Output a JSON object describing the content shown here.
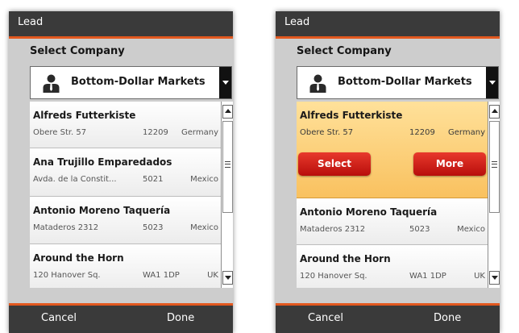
{
  "screens": [
    {
      "title": "Lead",
      "section_label": "Select Company",
      "dropdown": {
        "value": "Bottom-Dollar Markets",
        "icon": "person-icon"
      },
      "items": [
        {
          "name": "Alfreds Futterkiste",
          "address": "Obere Str. 57",
          "postal": "12209",
          "country": "Germany"
        },
        {
          "name": "Ana Trujillo Emparedados",
          "address": "Avda. de la Constit...",
          "postal": "5021",
          "country": "Mexico"
        },
        {
          "name": "Antonio Moreno Taquería",
          "address": "Mataderos 2312",
          "postal": "5023",
          "country": "Mexico"
        },
        {
          "name": "Around the Horn",
          "address": "120 Hanover Sq.",
          "postal": "WA1 1DP",
          "country": "UK"
        }
      ],
      "footer": {
        "cancel": "Cancel",
        "done": "Done"
      }
    },
    {
      "title": "Lead",
      "section_label": "Select Company",
      "dropdown": {
        "value": "Bottom-Dollar Markets",
        "icon": "person-icon"
      },
      "selected_index": 0,
      "selected_actions": {
        "select": "Select",
        "more": "More"
      },
      "items": [
        {
          "name": "Alfreds Futterkiste",
          "address": "Obere Str. 57",
          "postal": "12209",
          "country": "Germany"
        },
        {
          "name": "Antonio Moreno Taquería",
          "address": "Mataderos 2312",
          "postal": "5023",
          "country": "Mexico"
        },
        {
          "name": "Around the Horn",
          "address": "120 Hanover Sq.",
          "postal": "WA1 1DP",
          "country": "UK"
        }
      ],
      "footer": {
        "cancel": "Cancel",
        "done": "Done"
      }
    }
  ],
  "colors": {
    "title_bar": "#3a3a3a",
    "accent_orange": "#e2581f",
    "selected_row": "#fbcf78",
    "action_button_red": "#d4231c",
    "phone_background": "#cdcdcd"
  }
}
